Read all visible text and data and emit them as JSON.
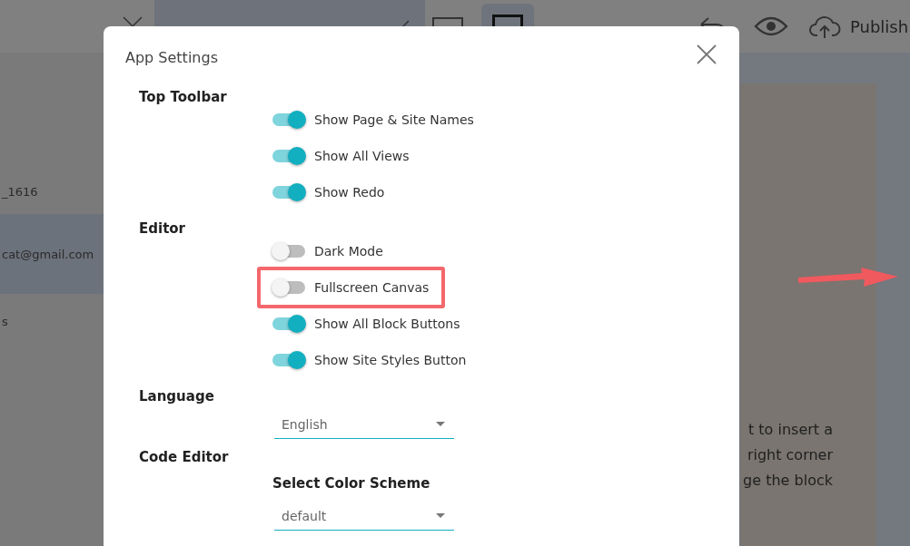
{
  "top_bar": {
    "publish_button": {
      "label": "Publish"
    }
  },
  "sidebar": {
    "items": [
      {
        "label": "_1616",
        "selected": false
      },
      {
        "label": "cat@gmail.com",
        "selected": true
      },
      {
        "label": "s",
        "selected": false
      }
    ]
  },
  "canvas": {
    "text_lines": [
      "t to insert a",
      "right corner",
      "ge the block"
    ]
  },
  "dialog": {
    "title": "App Settings",
    "sections": [
      {
        "heading": "Top Toolbar",
        "items": [
          {
            "kind": "toggle",
            "label": "Show Page & Site Names",
            "on": true,
            "highlighted": false
          },
          {
            "kind": "toggle",
            "label": "Show All Views",
            "on": true,
            "highlighted": false
          },
          {
            "kind": "toggle",
            "label": "Show Redo",
            "on": true,
            "highlighted": false
          }
        ]
      },
      {
        "heading": "Editor",
        "items": [
          {
            "kind": "toggle",
            "label": "Dark Mode",
            "on": false,
            "highlighted": false
          },
          {
            "kind": "toggle",
            "label": "Fullscreen Canvas",
            "on": false,
            "highlighted": true
          },
          {
            "kind": "toggle",
            "label": "Show All Block Buttons",
            "on": true,
            "highlighted": false
          },
          {
            "kind": "toggle",
            "label": "Show Site Styles Button",
            "on": true,
            "highlighted": false
          }
        ]
      },
      {
        "heading": "Language",
        "items": [
          {
            "kind": "select",
            "value": "English"
          }
        ]
      },
      {
        "heading": "Code Editor",
        "items": [
          {
            "kind": "subheading",
            "label": "Select Color Scheme"
          },
          {
            "kind": "select",
            "value": "default"
          }
        ]
      }
    ]
  }
}
